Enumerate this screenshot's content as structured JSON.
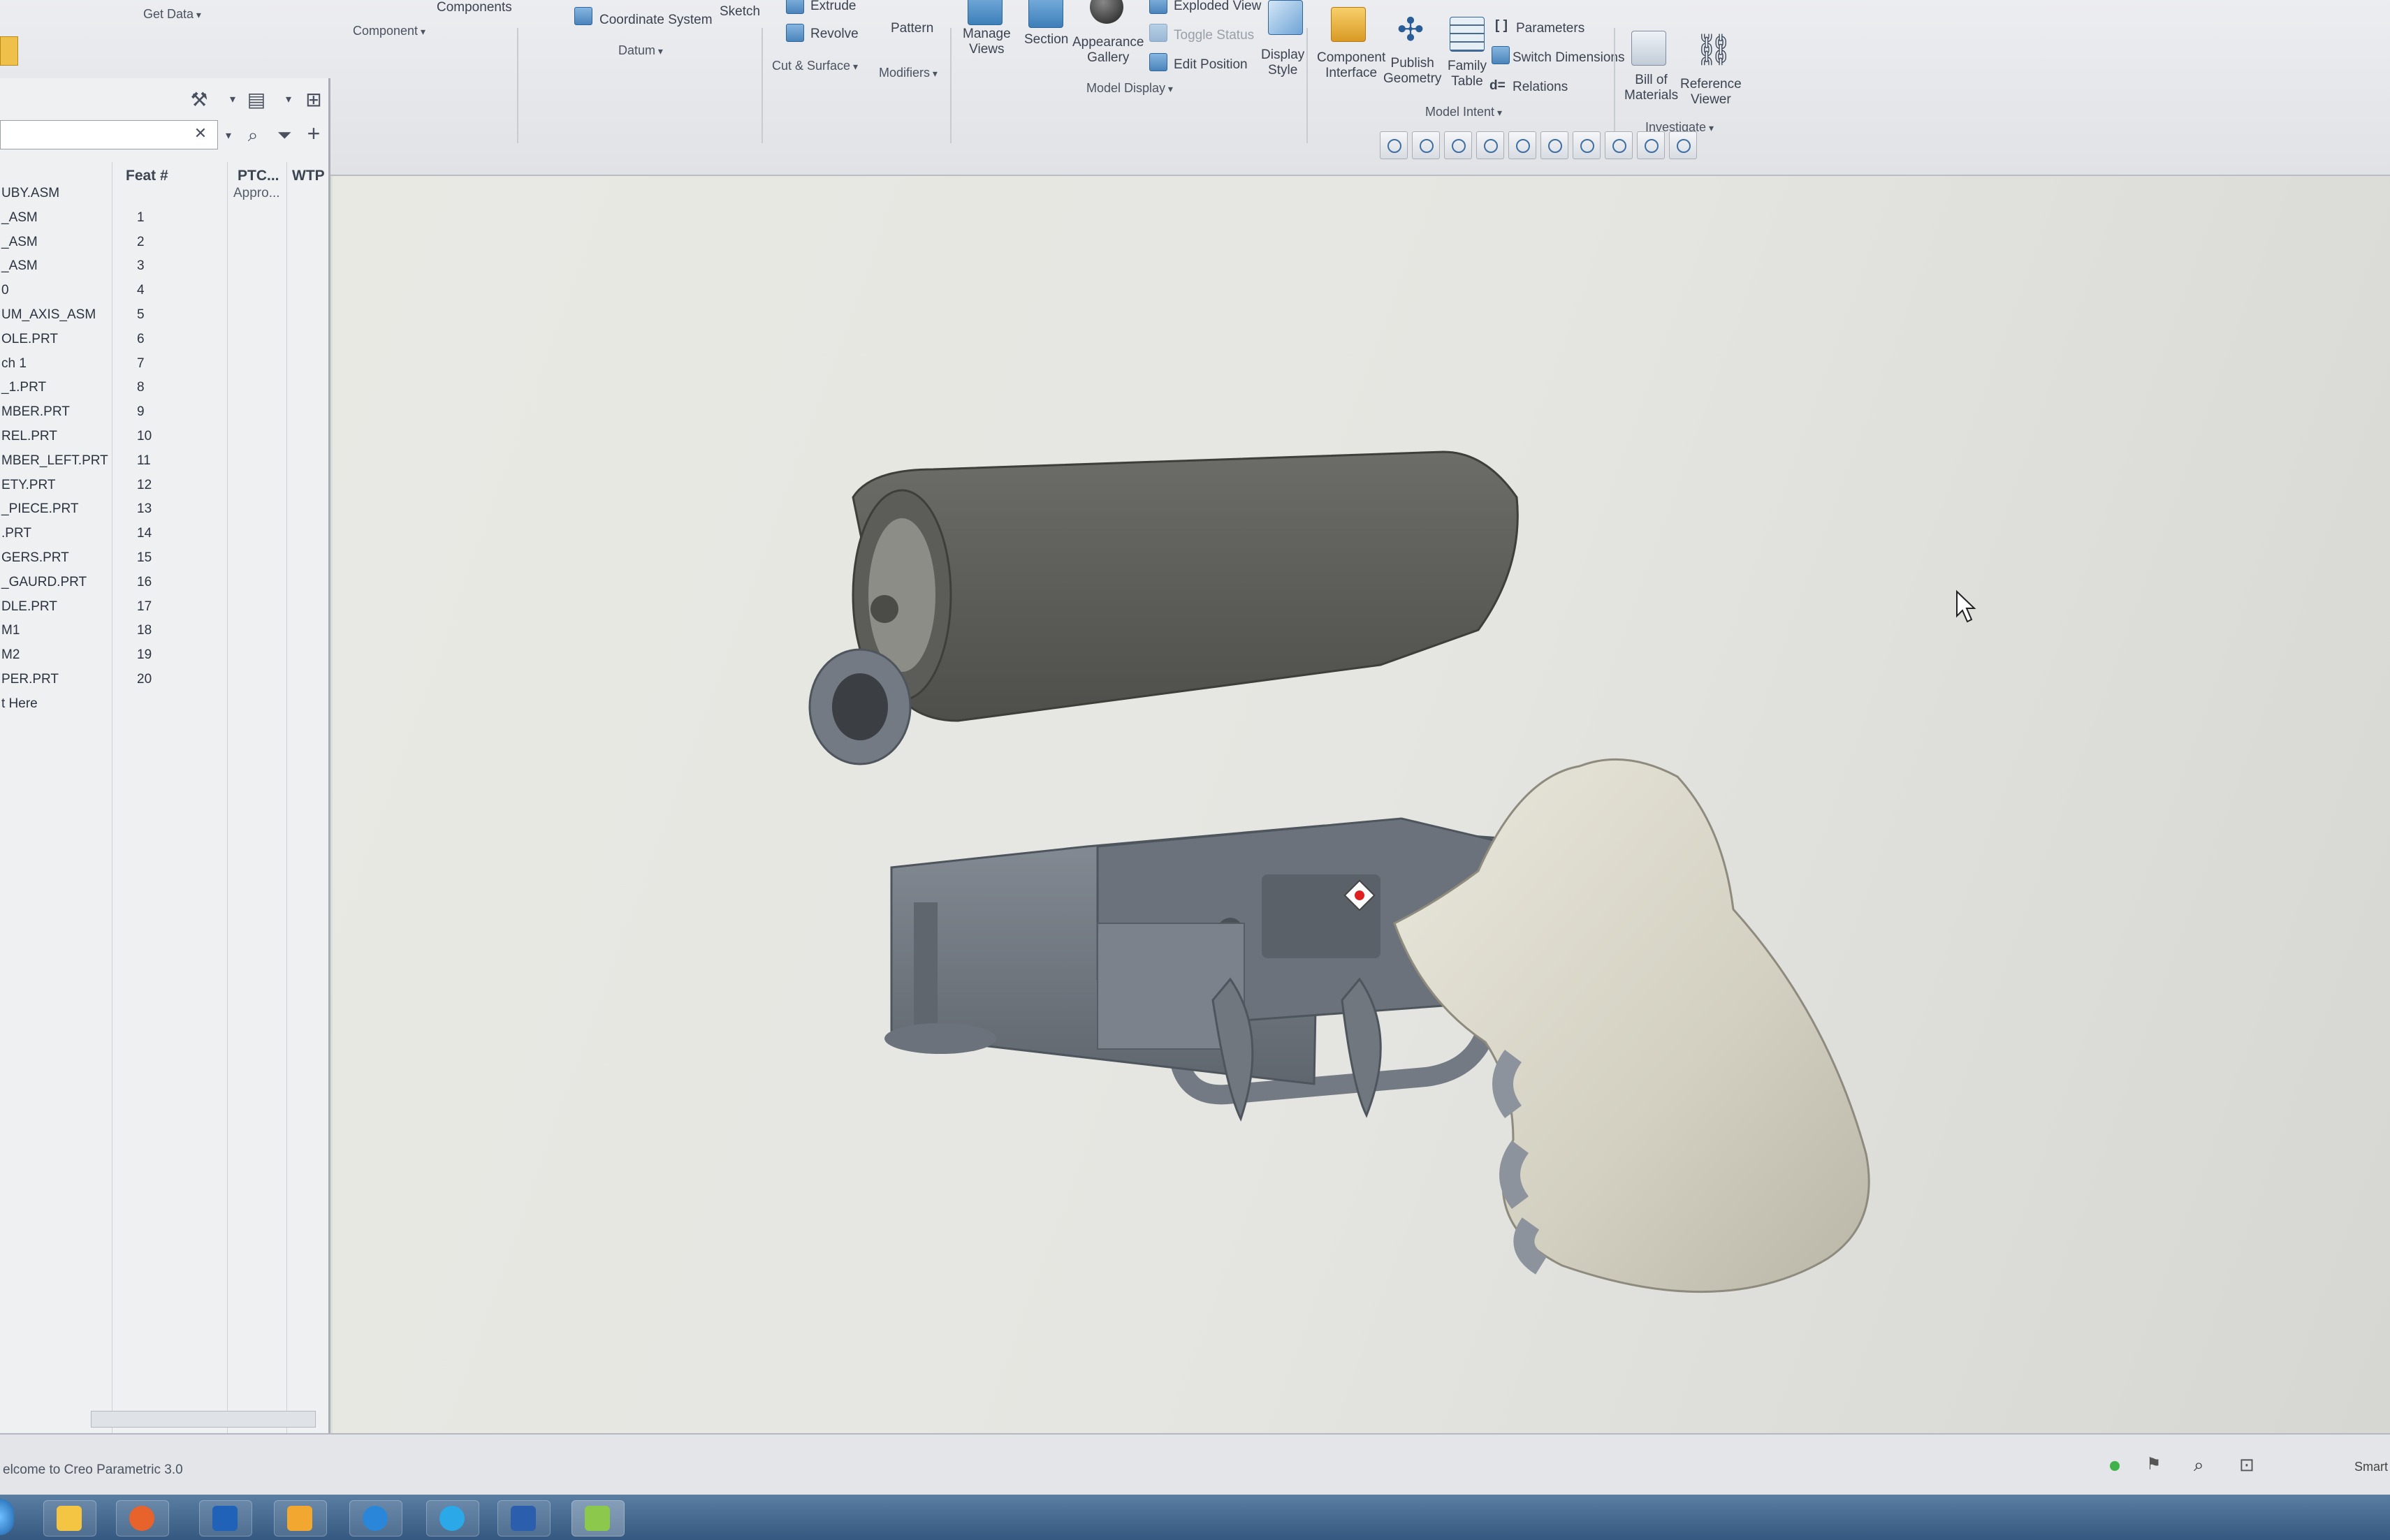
{
  "ribbon": {
    "get_data": "Get Data",
    "components": "Components",
    "component_group": "Component",
    "coordinate_system": "Coordinate System",
    "sketch": "Sketch",
    "datum_group": "Datum",
    "extrude": "Extrude",
    "revolve": "Revolve",
    "cut_surface_group": "Cut & Surface",
    "pattern": "Pattern",
    "modifiers_group": "Modifiers",
    "manage_views": "Manage\nViews",
    "section": "Section",
    "appearance_gallery": "Appearance\nGallery",
    "exploded_view": "Exploded View",
    "toggle_status": "Toggle Status",
    "edit_position": "Edit Position",
    "display_style": "Display\nStyle",
    "model_display_group": "Model Display",
    "component_interface": "Component\nInterface",
    "publish_geometry": "Publish\nGeometry",
    "family_table": "Family\nTable",
    "parameters": "Parameters",
    "switch_dimensions": "Switch Dimensions",
    "relations": "Relations",
    "model_intent_group": "Model Intent",
    "bill_of_materials": "Bill of\nMaterials",
    "reference_viewer": "Reference\nViewer",
    "investigate_group": "Investigate"
  },
  "tree": {
    "columns": {
      "feat": "Feat #",
      "ptc": "PTC...",
      "wtp": "WTP"
    },
    "rows": [
      {
        "name": "UBY.ASM",
        "feat": "",
        "ptc": "Appro..."
      },
      {
        "name": "_ASM",
        "feat": "1",
        "ptc": ""
      },
      {
        "name": "_ASM",
        "feat": "2",
        "ptc": ""
      },
      {
        "name": "_ASM",
        "feat": "3",
        "ptc": ""
      },
      {
        "name": "0",
        "feat": "4",
        "ptc": ""
      },
      {
        "name": "UM_AXIS_ASM",
        "feat": "5",
        "ptc": ""
      },
      {
        "name": "OLE.PRT",
        "feat": "6",
        "ptc": ""
      },
      {
        "name": "ch 1",
        "feat": "7",
        "ptc": ""
      },
      {
        "name": "_1.PRT",
        "feat": "8",
        "ptc": ""
      },
      {
        "name": "MBER.PRT",
        "feat": "9",
        "ptc": ""
      },
      {
        "name": "REL.PRT",
        "feat": "10",
        "ptc": ""
      },
      {
        "name": "MBER_LEFT.PRT",
        "feat": "11",
        "ptc": ""
      },
      {
        "name": "ETY.PRT",
        "feat": "12",
        "ptc": ""
      },
      {
        "name": "_PIECE.PRT",
        "feat": "13",
        "ptc": ""
      },
      {
        "name": ".PRT",
        "feat": "14",
        "ptc": ""
      },
      {
        "name": "GERS.PRT",
        "feat": "15",
        "ptc": ""
      },
      {
        "name": "_GAURD.PRT",
        "feat": "16",
        "ptc": ""
      },
      {
        "name": "DLE.PRT",
        "feat": "17",
        "ptc": ""
      },
      {
        "name": "M1",
        "feat": "18",
        "ptc": ""
      },
      {
        "name": "M2",
        "feat": "19",
        "ptc": ""
      },
      {
        "name": "PER.PRT",
        "feat": "20",
        "ptc": ""
      },
      {
        "name": "t Here",
        "feat": "",
        "ptc": ""
      }
    ]
  },
  "status": {
    "message": "elcome to Creo Parametric 3.0",
    "mode": "Smart"
  },
  "colors": {
    "frame_top": "#5c5c58",
    "frame_body": "#6f767f",
    "grip": "#d6d3c5",
    "grip_spacer": "#8c939c"
  }
}
